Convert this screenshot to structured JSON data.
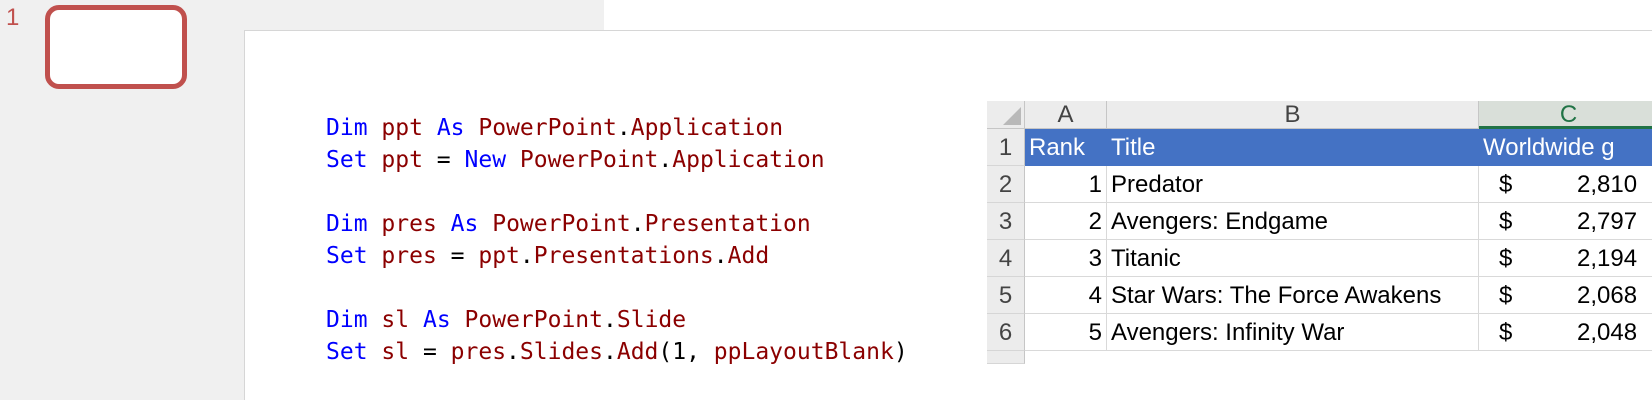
{
  "thumbnail": {
    "slide_number": "1"
  },
  "code_lines": [
    [
      {
        "t": "kw",
        "v": "Dim"
      },
      {
        "t": "p",
        "v": " "
      },
      {
        "t": "id",
        "v": "ppt"
      },
      {
        "t": "p",
        "v": " "
      },
      {
        "t": "kw",
        "v": "As"
      },
      {
        "t": "p",
        "v": " "
      },
      {
        "t": "id",
        "v": "PowerPoint"
      },
      {
        "t": "p",
        "v": "."
      },
      {
        "t": "id",
        "v": "Application"
      }
    ],
    [
      {
        "t": "kw",
        "v": "Set"
      },
      {
        "t": "p",
        "v": " "
      },
      {
        "t": "id",
        "v": "ppt"
      },
      {
        "t": "p",
        "v": " = "
      },
      {
        "t": "kw",
        "v": "New"
      },
      {
        "t": "p",
        "v": " "
      },
      {
        "t": "id",
        "v": "PowerPoint"
      },
      {
        "t": "p",
        "v": "."
      },
      {
        "t": "id",
        "v": "Application"
      }
    ],
    [],
    [
      {
        "t": "kw",
        "v": "Dim"
      },
      {
        "t": "p",
        "v": " "
      },
      {
        "t": "id",
        "v": "pres"
      },
      {
        "t": "p",
        "v": " "
      },
      {
        "t": "kw",
        "v": "As"
      },
      {
        "t": "p",
        "v": " "
      },
      {
        "t": "id",
        "v": "PowerPoint"
      },
      {
        "t": "p",
        "v": "."
      },
      {
        "t": "id",
        "v": "Presentation"
      }
    ],
    [
      {
        "t": "kw",
        "v": "Set"
      },
      {
        "t": "p",
        "v": " "
      },
      {
        "t": "id",
        "v": "pres"
      },
      {
        "t": "p",
        "v": " = "
      },
      {
        "t": "id",
        "v": "ppt"
      },
      {
        "t": "p",
        "v": "."
      },
      {
        "t": "id",
        "v": "Presentations"
      },
      {
        "t": "p",
        "v": "."
      },
      {
        "t": "id",
        "v": "Add"
      }
    ],
    [],
    [
      {
        "t": "kw",
        "v": "Dim"
      },
      {
        "t": "p",
        "v": " "
      },
      {
        "t": "id",
        "v": "sl"
      },
      {
        "t": "p",
        "v": " "
      },
      {
        "t": "kw",
        "v": "As"
      },
      {
        "t": "p",
        "v": " "
      },
      {
        "t": "id",
        "v": "PowerPoint"
      },
      {
        "t": "p",
        "v": "."
      },
      {
        "t": "id",
        "v": "Slide"
      }
    ],
    [
      {
        "t": "kw",
        "v": "Set"
      },
      {
        "t": "p",
        "v": " "
      },
      {
        "t": "id",
        "v": "sl"
      },
      {
        "t": "p",
        "v": " = "
      },
      {
        "t": "id",
        "v": "pres"
      },
      {
        "t": "p",
        "v": "."
      },
      {
        "t": "id",
        "v": "Slides"
      },
      {
        "t": "p",
        "v": "."
      },
      {
        "t": "id",
        "v": "Add"
      },
      {
        "t": "p",
        "v": "(1, "
      },
      {
        "t": "id",
        "v": "ppLayoutBlank"
      },
      {
        "t": "p",
        "v": ")"
      }
    ]
  ],
  "sheet": {
    "columns": [
      "A",
      "B",
      "C"
    ],
    "header": [
      "Rank",
      "Title",
      "Worldwide g"
    ],
    "rows": [
      {
        "rownum": "1"
      },
      {
        "rownum": "2",
        "rank": "1",
        "title": "Predator",
        "dollar": "$",
        "amt": "2,810"
      },
      {
        "rownum": "3",
        "rank": "2",
        "title": "Avengers: Endgame",
        "dollar": "$",
        "amt": "2,797"
      },
      {
        "rownum": "4",
        "rank": "3",
        "title": "Titanic",
        "dollar": "$",
        "amt": "2,194"
      },
      {
        "rownum": "5",
        "rank": "4",
        "title": "Star Wars: The Force Awakens",
        "dollar": "$",
        "amt": "2,068"
      },
      {
        "rownum": "6",
        "rank": "5",
        "title": "Avengers: Infinity War",
        "dollar": "$",
        "amt": "2,048"
      }
    ]
  },
  "colors": {
    "thumb_border": "#c0504d",
    "keyword": "#0000ff",
    "identifier": "#8b0000",
    "table_header": "#4472c4",
    "selected_column": "#217346"
  }
}
